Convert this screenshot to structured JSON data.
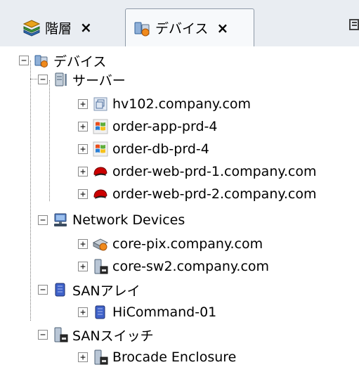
{
  "tabs": [
    {
      "label": "階層",
      "icon": "layers-icon"
    },
    {
      "label": "デバイス",
      "icon": "devices-icon",
      "active": true
    }
  ],
  "tab_close_glyph": "×",
  "tree": {
    "root": {
      "label": "デバイス",
      "icon": "devices-icon",
      "expander": "−"
    },
    "servers": {
      "label": "サーバー",
      "icon": "server-icon",
      "expander": "−"
    },
    "server_items": [
      {
        "label": "hv102.company.com",
        "icon": "vm-host-icon"
      },
      {
        "label": "order-app-prd-4",
        "icon": "windows-icon"
      },
      {
        "label": "order-db-prd-4",
        "icon": "windows-icon"
      },
      {
        "label": "order-web-prd-1.company.com",
        "icon": "redhat-icon"
      },
      {
        "label": "order-web-prd-2.company.com",
        "icon": "redhat-icon"
      }
    ],
    "network": {
      "label": "Network Devices",
      "icon": "network-icon",
      "expander": "−"
    },
    "network_items": [
      {
        "label": "core-pix.company.com",
        "icon": "firewall-icon"
      },
      {
        "label": "core-sw2.company.com",
        "icon": "switch-icon"
      }
    ],
    "san_array": {
      "label": "SANアレイ",
      "icon": "storage-array-icon",
      "expander": "−"
    },
    "san_array_items": [
      {
        "label": "HiCommand-01",
        "icon": "storage-array-icon"
      }
    ],
    "san_switch": {
      "label": "SANスイッチ",
      "icon": "san-switch-icon",
      "expander": "−"
    },
    "san_switch_items": [
      {
        "label": "Brocade Enclosure",
        "icon": "san-switch-icon"
      }
    ],
    "collapsed_glyph": "+"
  },
  "colors": {
    "tabstrip": "#e9edf2",
    "tree_bg": "#ffffff",
    "accent_blue": "#2f6db5"
  }
}
